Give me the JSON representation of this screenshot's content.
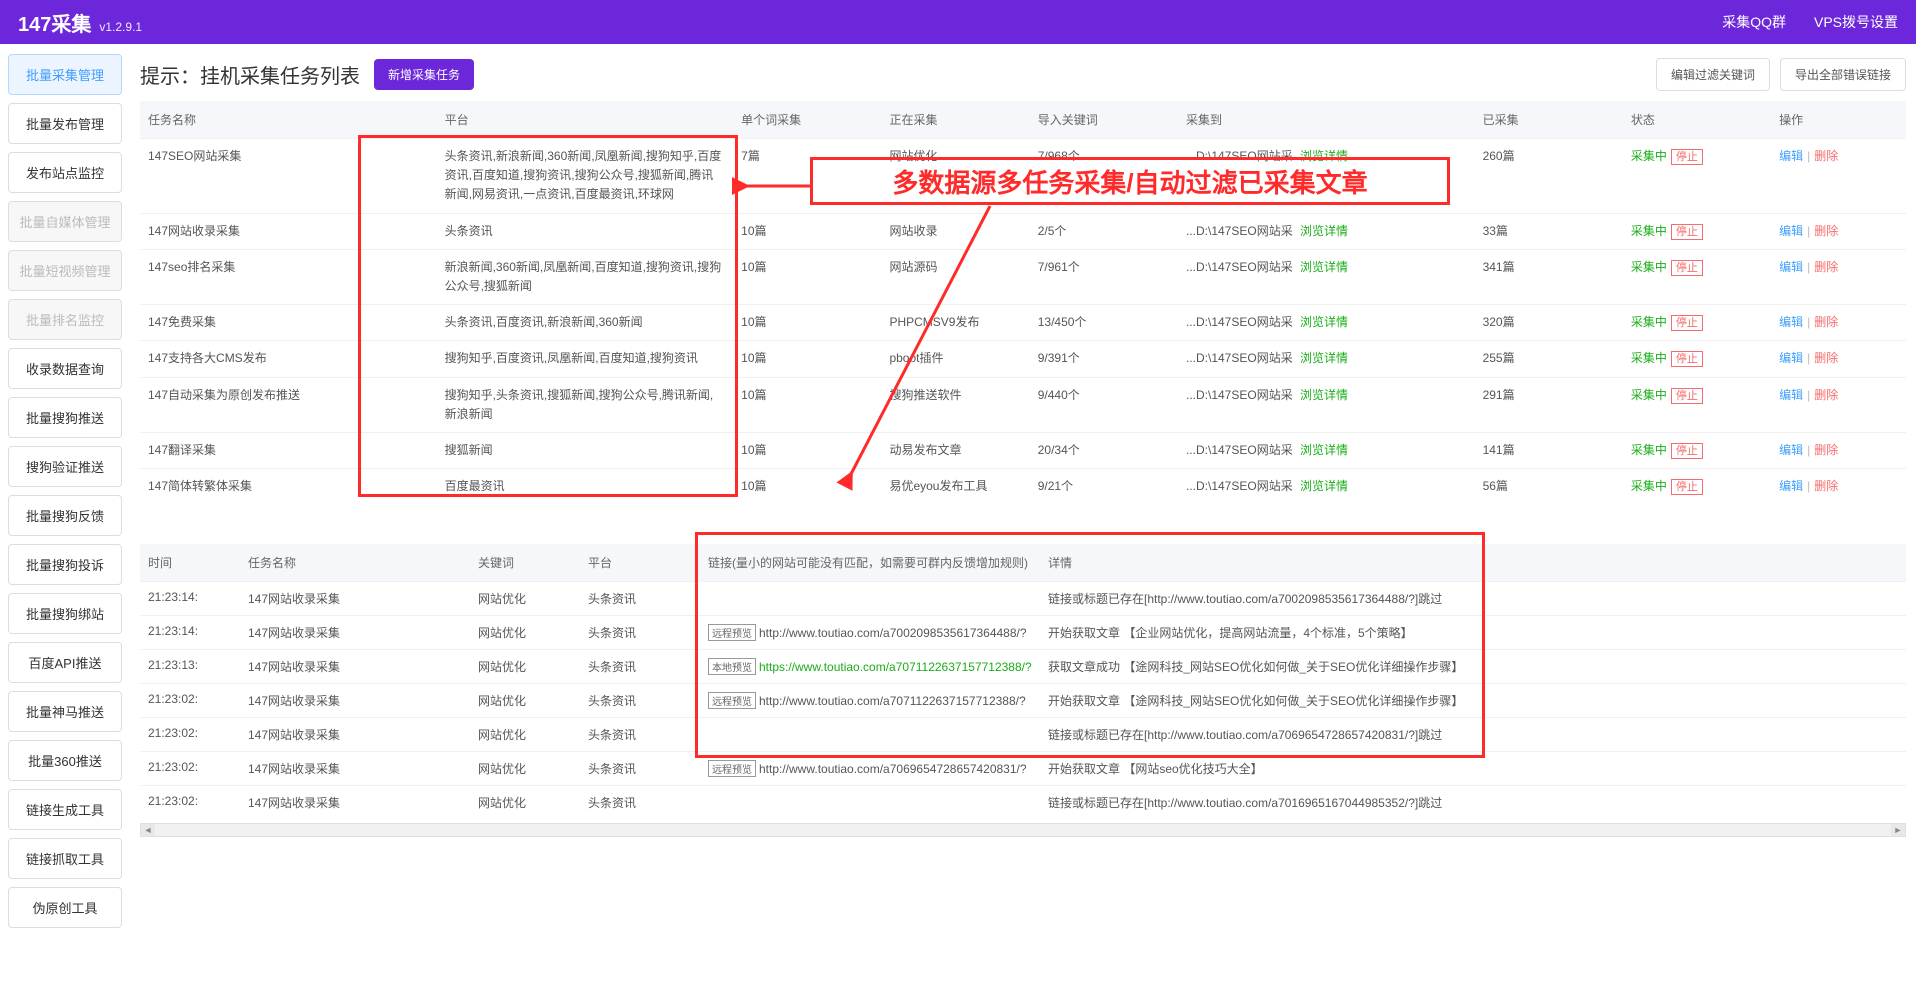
{
  "app": {
    "title": "147采集",
    "version": "v1.2.9.1"
  },
  "topnav": {
    "qqgroup": "采集QQ群",
    "vps": "VPS拨号设置"
  },
  "sidebar": [
    {
      "label": "批量采集管理",
      "state": "active"
    },
    {
      "label": "批量发布管理",
      "state": ""
    },
    {
      "label": "发布站点监控",
      "state": ""
    },
    {
      "label": "批量自媒体管理",
      "state": "disabled"
    },
    {
      "label": "批量短视频管理",
      "state": "disabled"
    },
    {
      "label": "批量排名监控",
      "state": "disabled"
    },
    {
      "label": "收录数据查询",
      "state": ""
    },
    {
      "label": "批量搜狗推送",
      "state": ""
    },
    {
      "label": "搜狗验证推送",
      "state": ""
    },
    {
      "label": "批量搜狗反馈",
      "state": ""
    },
    {
      "label": "批量搜狗投诉",
      "state": ""
    },
    {
      "label": "批量搜狗绑站",
      "state": ""
    },
    {
      "label": "百度API推送",
      "state": ""
    },
    {
      "label": "批量神马推送",
      "state": ""
    },
    {
      "label": "批量360推送",
      "state": ""
    },
    {
      "label": "链接生成工具",
      "state": ""
    },
    {
      "label": "链接抓取工具",
      "state": ""
    },
    {
      "label": "伪原创工具",
      "state": ""
    }
  ],
  "header": {
    "title": "提示：挂机采集任务列表",
    "newTask": "新增采集任务",
    "editFilter": "编辑过滤关键词",
    "exportErr": "导出全部错误链接"
  },
  "taskCols": {
    "name": "任务名称",
    "platform": "平台",
    "single": "单个词采集",
    "collecting": "正在采集",
    "imported": "导入关键词",
    "target": "采集到",
    "collected": "已采集",
    "status": "状态",
    "op": "操作"
  },
  "browse": "浏览详情",
  "statusText": "采集中",
  "stopText": "停止",
  "editText": "编辑",
  "deleteText": "删除",
  "tasks": [
    {
      "name": "147SEO网站采集",
      "platform": "头条资讯,新浪新闻,360新闻,凤凰新闻,搜狗知乎,百度资讯,百度知道,搜狗资讯,搜狗公众号,搜狐新闻,腾讯新闻,网易资讯,一点资讯,百度最资讯,环球网",
      "single": "7篇",
      "collecting": "网站优化",
      "imported": "7/968个",
      "target": "...D:\\147SEO网站采",
      "collected": "260篇"
    },
    {
      "name": "147网站收录采集",
      "platform": "头条资讯",
      "single": "10篇",
      "collecting": "网站收录",
      "imported": "2/5个",
      "target": "...D:\\147SEO网站采",
      "collected": "33篇"
    },
    {
      "name": "147seo排名采集",
      "platform": "新浪新闻,360新闻,凤凰新闻,百度知道,搜狗资讯,搜狗公众号,搜狐新闻",
      "single": "10篇",
      "collecting": "网站源码",
      "imported": "7/961个",
      "target": "...D:\\147SEO网站采",
      "collected": "341篇"
    },
    {
      "name": "147免费采集",
      "platform": "头条资讯,百度资讯,新浪新闻,360新闻",
      "single": "10篇",
      "collecting": "PHPCMSV9发布",
      "imported": "13/450个",
      "target": "...D:\\147SEO网站采",
      "collected": "320篇"
    },
    {
      "name": "147支持各大CMS发布",
      "platform": "搜狗知乎,百度资讯,凤凰新闻,百度知道,搜狗资讯",
      "single": "10篇",
      "collecting": "pboot插件",
      "imported": "9/391个",
      "target": "...D:\\147SEO网站采",
      "collected": "255篇"
    },
    {
      "name": "147自动采集为原创发布推送",
      "platform": "搜狗知乎,头条资讯,搜狐新闻,搜狗公众号,腾讯新闻,新浪新闻",
      "single": "10篇",
      "collecting": "搜狗推送软件",
      "imported": "9/440个",
      "target": "...D:\\147SEO网站采",
      "collected": "291篇"
    },
    {
      "name": "147翻译采集",
      "platform": "搜狐新闻",
      "single": "10篇",
      "collecting": "动易发布文章",
      "imported": "20/34个",
      "target": "...D:\\147SEO网站采",
      "collected": "141篇"
    },
    {
      "name": "147简体转繁体采集",
      "platform": "百度最资讯",
      "single": "10篇",
      "collecting": "易优eyou发布工具",
      "imported": "9/21个",
      "target": "...D:\\147SEO网站采",
      "collected": "56篇"
    }
  ],
  "annotation": {
    "text": "多数据源多任务采集/自动过滤已采集文章"
  },
  "logCols": {
    "time": "时间",
    "task": "任务名称",
    "keyword": "关键词",
    "platform": "平台",
    "link": "链接(量小的网站可能没有匹配，如需要可群内反馈增加规则)",
    "detail": "详情"
  },
  "tagRemote": "远程预览",
  "tagLocal": "本地预览",
  "logs": [
    {
      "time": "21:23:14:",
      "task": "147网站收录采集",
      "keyword": "网站优化",
      "platform": "头条资讯",
      "link": "",
      "tag": "",
      "detail": "链接或标题已存在[http://www.toutiao.com/a7002098535617364488/?]跳过"
    },
    {
      "time": "21:23:14:",
      "task": "147网站收录采集",
      "keyword": "网站优化",
      "platform": "头条资讯",
      "link": "http://www.toutiao.com/a7002098535617364488/?",
      "tag": "remote",
      "detail": "开始获取文章 【企业网站优化，提高网站流量，4个标准，5个策略】"
    },
    {
      "time": "21:23:13:",
      "task": "147网站收录采集",
      "keyword": "网站优化",
      "platform": "头条资讯",
      "link": "https://www.toutiao.com/a7071122637157712388/?",
      "tag": "local",
      "detail": "获取文章成功 【途网科技_网站SEO优化如何做_关于SEO优化详细操作步骤】"
    },
    {
      "time": "21:23:02:",
      "task": "147网站收录采集",
      "keyword": "网站优化",
      "platform": "头条资讯",
      "link": "http://www.toutiao.com/a7071122637157712388/?",
      "tag": "remote",
      "detail": "开始获取文章 【途网科技_网站SEO优化如何做_关于SEO优化详细操作步骤】"
    },
    {
      "time": "21:23:02:",
      "task": "147网站收录采集",
      "keyword": "网站优化",
      "platform": "头条资讯",
      "link": "",
      "tag": "",
      "detail": "链接或标题已存在[http://www.toutiao.com/a7069654728657420831/?]跳过"
    },
    {
      "time": "21:23:02:",
      "task": "147网站收录采集",
      "keyword": "网站优化",
      "platform": "头条资讯",
      "link": "http://www.toutiao.com/a7069654728657420831/?",
      "tag": "remote",
      "detail": "开始获取文章 【网站seo优化技巧大全】"
    },
    {
      "time": "21:23:02:",
      "task": "147网站收录采集",
      "keyword": "网站优化",
      "platform": "头条资讯",
      "link": "",
      "tag": "",
      "detail": "链接或标题已存在[http://www.toutiao.com/a7016965167044985352/?]跳过"
    }
  ]
}
